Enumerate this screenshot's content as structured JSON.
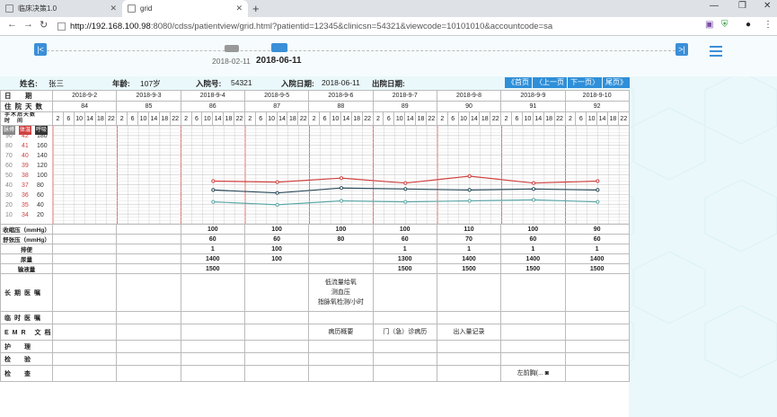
{
  "browser": {
    "tab1": "临床决策1.0",
    "tab2": "grid",
    "url_host": "http://192.168.100.98",
    "url_rest": ":8080/cdss/patientview/grid.html?patientid=12345&clinicsn=54321&viewcode=10101010&accountcode=sa"
  },
  "timeline": {
    "date1": "2018-02-11",
    "date2": "2018-06-11"
  },
  "patient": {
    "name_label": "姓名:",
    "name": "张三",
    "age_label": "年龄:",
    "age": "107岁",
    "admit_no_label": "入院号:",
    "admit_no": "54321",
    "admit_date_label": "入院日期:",
    "admit_date": "2018-06-11",
    "discharge_label": "出院日期:"
  },
  "pager": {
    "first": "《首页",
    "prev": "〈上一页",
    "next": "下一页〉",
    "last": "尾页》"
  },
  "rows": {
    "date": "日　期",
    "days": "住院天数",
    "postop": "手术后天数",
    "time": "时　间"
  },
  "dates": [
    "2018-9-2",
    "2018-9-3",
    "2018-9-4",
    "2018-9-5",
    "2018-9-6",
    "2018-9-7",
    "2018-9-8",
    "2018-9-9",
    "2018-9-10"
  ],
  "days": [
    "84",
    "85",
    "86",
    "87",
    "88",
    "89",
    "90",
    "91",
    "92"
  ],
  "hours": [
    "2",
    "6",
    "10",
    "14",
    "18",
    "22"
  ],
  "axis": {
    "h1": "脉搏",
    "h2": "体温",
    "h3": "呼吸",
    "pulse": [
      "90",
      "80",
      "70",
      "60",
      "50",
      "40",
      "30",
      "20",
      "10"
    ],
    "temp": [
      "42",
      "41",
      "40",
      "39",
      "38",
      "37",
      "36",
      "35",
      "34"
    ],
    "resp": [
      "180",
      "160",
      "140",
      "120",
      "100",
      "80",
      "60",
      "40",
      "20"
    ]
  },
  "chart_data": {
    "type": "line",
    "x": [
      "2018-9-4",
      "2018-9-5",
      "2018-9-6",
      "2018-9-7",
      "2018-9-8",
      "2018-9-9",
      "2018-9-10"
    ],
    "series": [
      {
        "values": [
          37.5,
          37.4,
          37.8,
          37.3,
          38.0,
          37.3,
          37.5
        ],
        "color": "#d04040"
      },
      {
        "values": [
          36.6,
          36.3,
          36.8,
          36.7,
          36.6,
          36.7,
          36.6
        ],
        "color": "#2a4a5a"
      },
      {
        "values": [
          35.4,
          35.1,
          35.5,
          35.4,
          35.5,
          35.6,
          35.4
        ],
        "color": "#5fa8a8"
      }
    ]
  },
  "measures": [
    {
      "label": "收缩压（mmHg）",
      "vals": [
        "",
        "",
        "100",
        "100",
        "100",
        "100",
        "110",
        "100",
        "90"
      ]
    },
    {
      "label": "舒张压（mmHg）",
      "vals": [
        "",
        "",
        "60",
        "60",
        "80",
        "60",
        "70",
        "60",
        "60"
      ]
    },
    {
      "label": "排便",
      "vals": [
        "",
        "",
        "1",
        "100",
        "",
        "1",
        "1",
        "1",
        "1"
      ]
    },
    {
      "label": "尿量",
      "vals": [
        "",
        "",
        "1400",
        "100",
        "",
        "1300",
        "1400",
        "1400",
        "1400"
      ]
    },
    {
      "label": "输液量",
      "vals": [
        "",
        "",
        "1500",
        "",
        "",
        "1500",
        "1500",
        "1500",
        "1500"
      ]
    }
  ],
  "big": {
    "long_order": "长期医嘱",
    "long_text": [
      "低流量给氧",
      "测血压",
      "指脉氧检测/小时"
    ],
    "temp_order": "临时医嘱",
    "emr": "EMR 文档",
    "emr_a": "病历概要",
    "emr_b": "门（急）诊病历",
    "emr_c": "出入量记录",
    "nursing": "护　理",
    "exam": "检　验",
    "check": "检　查",
    "check_text": "左前胸(..."
  }
}
